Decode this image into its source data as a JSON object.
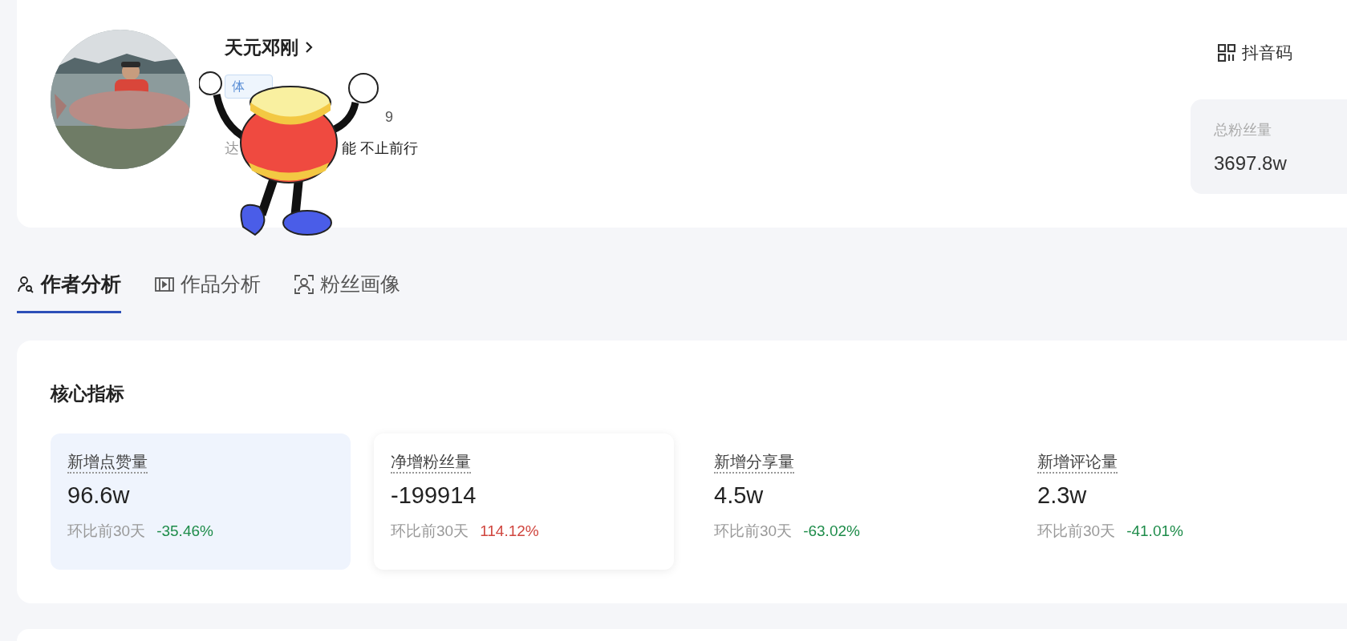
{
  "profile": {
    "name": "天元邓刚",
    "tag": "体",
    "line_2_end": "9",
    "line_3_start": "达",
    "line_3_end": "能 不止前行"
  },
  "douyin_code": "抖音码",
  "total_fans": {
    "label": "总粉丝量",
    "value": "3697.8w"
  },
  "tabs": [
    {
      "label": "作者分析",
      "kind": "author",
      "selected": true
    },
    {
      "label": "作品分析",
      "kind": "video",
      "selected": false
    },
    {
      "label": "粉丝画像",
      "kind": "fans",
      "selected": false
    }
  ],
  "core": {
    "title": "核心指标",
    "metrics": [
      {
        "label": "新增点赞量",
        "value": "96.6w",
        "compare_label": "环比前30天",
        "change": "-35.46%",
        "color": "#1e8c4a",
        "selected": true,
        "hovered": false
      },
      {
        "label": "净增粉丝量",
        "value": "-199914",
        "compare_label": "环比前30天",
        "change": "114.12%",
        "color": "#d0463f",
        "selected": false,
        "hovered": true
      },
      {
        "label": "新增分享量",
        "value": "4.5w",
        "compare_label": "环比前30天",
        "change": "-63.02%",
        "color": "#1e8c4a",
        "selected": false,
        "hovered": false
      },
      {
        "label": "新增评论量",
        "value": "2.3w",
        "compare_label": "环比前30天",
        "change": "-41.01%",
        "color": "#1e8c4a",
        "selected": false,
        "hovered": false
      }
    ]
  }
}
